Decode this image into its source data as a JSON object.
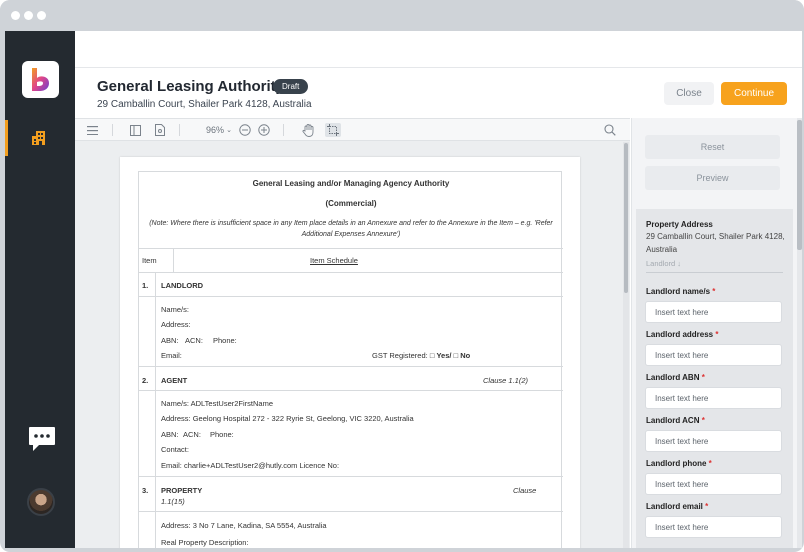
{
  "header": {
    "title": "General Leasing Authority",
    "badge": "Draft",
    "address": "29 Camballin Court, Shailer Park 4128, Australia",
    "close_label": "Close",
    "continue_label": "Continue"
  },
  "toolbar": {
    "zoom": "96%"
  },
  "document": {
    "title": "General Leasing and/or Managing Agency Authority",
    "subtitle": "(Commercial)",
    "note": "(Note: Where there is insufficient space in any Item place details in an Annexure and refer to the Annexure in the Item – e.g. 'Refer Additional Expenses Annexure')",
    "col_item": "Item",
    "col_schedule": "Item Schedule",
    "s1_num": "1.",
    "s1_title": "LANDLORD",
    "s1_names": "Name/s:",
    "s1_address": "Address:",
    "s1_abn": "ABN:",
    "s1_acn": "ACN:",
    "s1_phone": "Phone:",
    "s1_email": "Email:",
    "s1_gst": "GST Registered:",
    "s1_box_yes": "□",
    "s1_yes": "Yes/",
    "s1_box_no": "□",
    "s1_no": "No",
    "s2_num": "2.",
    "s2_title": "AGENT",
    "s2_clause": "Clause 1.1(2)",
    "s2_names_label": "Name/s:",
    "s2_names": "ADLTestUser2FirstName",
    "s2_address_label": "Address:",
    "s2_address": "Geelong Hospital 272 - 322 Ryrie St, Geelong, VIC 3220, Australia",
    "s2_abn": "ABN:",
    "s2_acn": "ACN:",
    "s2_phone": "Phone:",
    "s2_contact": "Contact:",
    "s2_email_label": "Email:",
    "s2_email": "charlie+ADLTestUser2@hutly.com",
    "s2_licence": "Licence No:",
    "s3_num": "3.",
    "s3_title": "PROPERTY",
    "s3_clause_a": "Clause",
    "s3_clause_b": "1.1(15)",
    "s3_address_label": "Address:",
    "s3_address": "3 No 7 Lane, Kadina, SA 5554, Australia",
    "s3_real": "Real Property Description:"
  },
  "panel": {
    "reset_label": "Reset",
    "preview_label": "Preview",
    "property_address_label": "Property Address",
    "property_address_value": "29 Camballin Court, Shailer Park 4128, Australia",
    "landlord_sub": "Landlord ↓",
    "required_mark": "*",
    "fields": [
      {
        "label": "Landlord name/s",
        "placeholder": "Insert text here"
      },
      {
        "label": "Landlord address",
        "placeholder": "Insert text here"
      },
      {
        "label": "Landlord ABN",
        "placeholder": "Insert text here"
      },
      {
        "label": "Landlord ACN",
        "placeholder": "Insert text here"
      },
      {
        "label": "Landlord phone",
        "placeholder": "Insert text here"
      },
      {
        "label": "Landlord email",
        "placeholder": "Insert text here"
      }
    ]
  },
  "icons": {
    "menu": "menu-icon",
    "sidebar_toggle": "panel-icon",
    "document": "document-icon",
    "zoom_out": "zoom-out-icon",
    "zoom_in": "zoom-in-icon",
    "pan": "hand-icon",
    "select": "select-area-icon",
    "search": "search-icon",
    "nav_building": "building-icon",
    "chat": "chat-icon"
  },
  "colors": {
    "accent": "#f7a21d",
    "sidebar": "#242a30",
    "badge": "#38424c",
    "required": "#d33333"
  }
}
